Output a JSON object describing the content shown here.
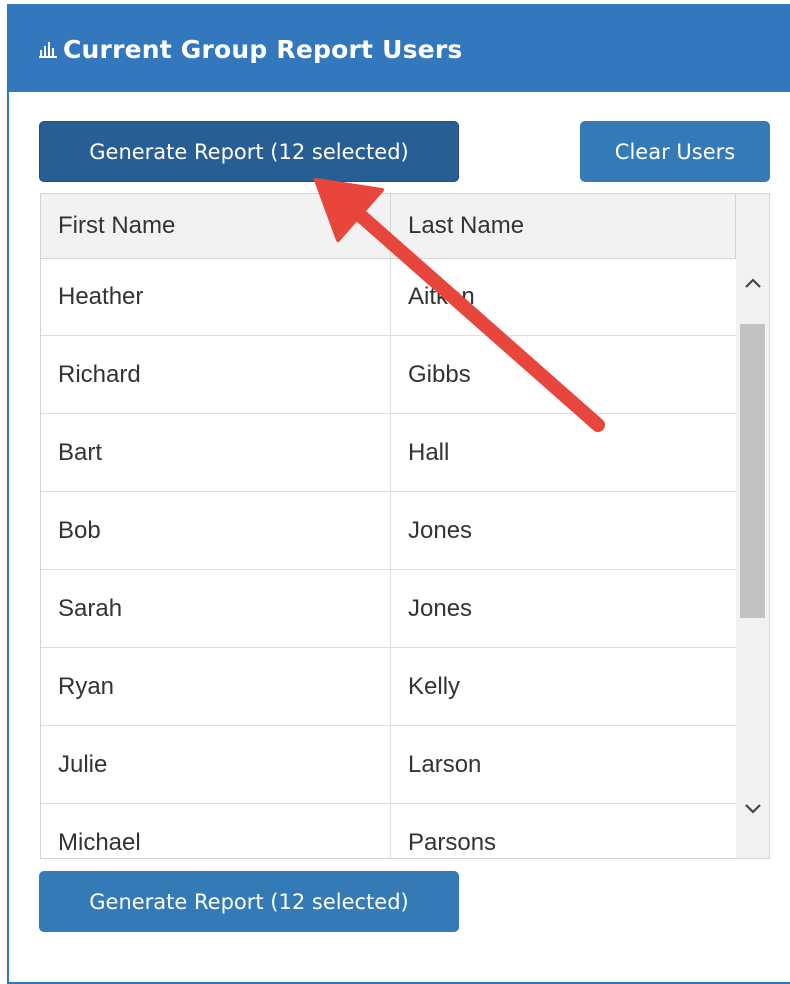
{
  "panel": {
    "title": "Current Group Report Users",
    "title_icon": "bar-chart-icon"
  },
  "buttons": {
    "generate_top": "Generate Report (12 selected)",
    "clear_users": "Clear Users",
    "generate_bottom": "Generate Report (12 selected)"
  },
  "table": {
    "headers": [
      "First Name",
      "Last Name"
    ],
    "rows": [
      [
        "Heather",
        "Aitken"
      ],
      [
        "Richard",
        "Gibbs"
      ],
      [
        "Bart",
        "Hall"
      ],
      [
        "Bob",
        "Jones"
      ],
      [
        "Sarah",
        "Jones"
      ],
      [
        "Ryan",
        "Kelly"
      ],
      [
        "Julie",
        "Larson"
      ],
      [
        "Michael",
        "Parsons"
      ]
    ]
  },
  "colors": {
    "primary": "#337ab7",
    "primary_dark": "#275e94",
    "annotation_arrow": "#e8463c"
  }
}
